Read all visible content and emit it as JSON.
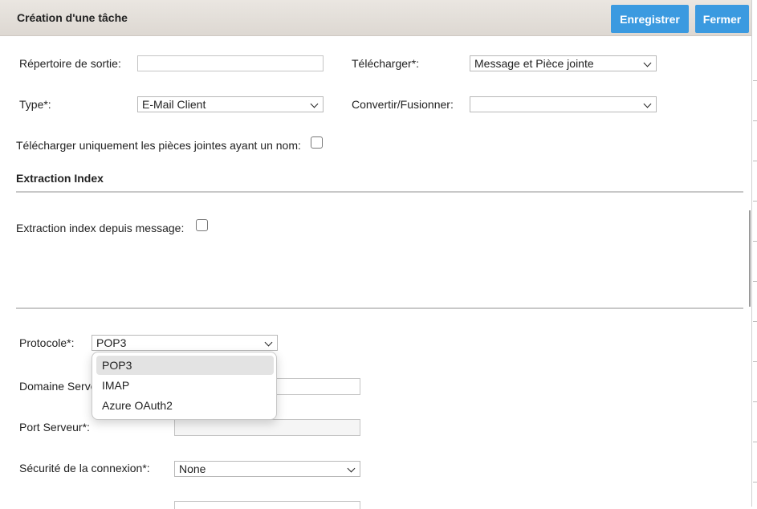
{
  "dialog": {
    "title": "Création d'une tâche",
    "save_label": "Enregistrer",
    "close_label": "Fermer"
  },
  "form": {
    "output_dir_label": "Répertoire de sortie:",
    "output_dir_value": "",
    "download_label": "Télécharger*:",
    "download_value": "Message et Pièce jointe",
    "type_label": "Type*:",
    "type_value": "E-Mail Client",
    "convert_label": "Convertir/Fusionner:",
    "convert_value": "",
    "named_attachments_label": "Télécharger uniquement les pièces jointes ayant un nom:",
    "named_attachments_checked": false
  },
  "index_section": {
    "title": "Extraction Index",
    "from_message_label": "Extraction index depuis message:",
    "from_message_checked": false
  },
  "connection": {
    "protocol_label": "Protocole*:",
    "protocol_value": "POP3",
    "protocol_options": [
      "POP3",
      "IMAP",
      "Azure OAuth2"
    ],
    "protocol_selected_index": 0,
    "server_domain_label": "Domaine Serveur*:",
    "server_domain_visible": "Domaine Serve",
    "server_domain_value": "",
    "server_port_label": "Port Serveur*:",
    "server_port_value": "",
    "security_label": "Sécurité de la connexion*:",
    "security_value": "None"
  },
  "colors": {
    "primary_button": "#3b9ae0",
    "header_bg": "#e3dfda",
    "option_highlight": "#e3e3e3"
  }
}
